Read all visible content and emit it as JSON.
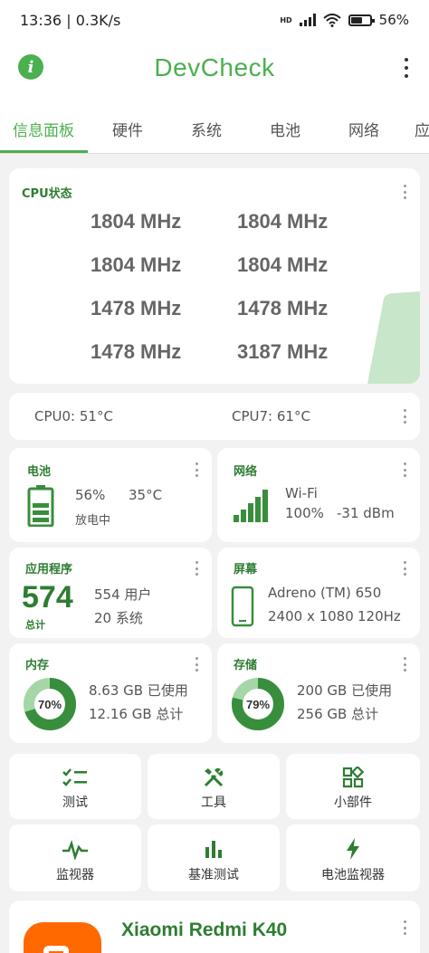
{
  "status_bar": {
    "time": "13:36",
    "speed": "0.3K/s",
    "battery": "56%",
    "network_badge": "HD"
  },
  "app_bar": {
    "title": "DevCheck"
  },
  "tabs": [
    {
      "label": "信息面板"
    },
    {
      "label": "硬件"
    },
    {
      "label": "系统"
    },
    {
      "label": "电池"
    },
    {
      "label": "网络"
    },
    {
      "label": "应"
    }
  ],
  "cpu_card": {
    "title": "CPU状态",
    "freqs": [
      "1804 MHz",
      "1804 MHz",
      "1804 MHz",
      "1804 MHz",
      "1478 MHz",
      "1478 MHz",
      "1478 MHz",
      "3187 MHz"
    ],
    "load_level": 0.78
  },
  "temp_card": {
    "cpu0": "CPU0: 51°C",
    "cpu7": "CPU7: 61°C"
  },
  "battery_card": {
    "title": "电池",
    "level": "56%",
    "temp": "35°C",
    "status": "放电中"
  },
  "network_card": {
    "title": "网络",
    "type": "Wi-Fi",
    "signal_pct": "100%",
    "signal_dbm": "-31 dBm"
  },
  "apps_card": {
    "title": "应用程序",
    "total": "574",
    "total_label": "总计",
    "user": "554 用户",
    "system": "20 系统"
  },
  "screen_card": {
    "title": "屏幕",
    "gpu": "Adreno (TM) 650",
    "resolution": "2400 x 1080",
    "refresh": "120Hz"
  },
  "memory_card": {
    "title": "内存",
    "percent": "70%",
    "percent_value": 70,
    "used": "8.63 GB 已使用",
    "total": "12.16 GB 总计"
  },
  "storage_card": {
    "title": "存储",
    "percent": "79%",
    "percent_value": 79,
    "used": "200 GB 已使用",
    "total": "256 GB 总计"
  },
  "tools": [
    {
      "label": "测试",
      "icon": "checklist-icon"
    },
    {
      "label": "工具",
      "icon": "tools-icon"
    },
    {
      "label": "小部件",
      "icon": "widgets-icon"
    },
    {
      "label": "监视器",
      "icon": "pulse-icon"
    },
    {
      "label": "基准测试",
      "icon": "bar-chart-icon"
    },
    {
      "label": "电池监视器",
      "icon": "bolt-icon"
    }
  ],
  "device_card": {
    "name": "Xiaomi Redmi K40"
  },
  "colors": {
    "accent": "#4caf50",
    "accent_dark": "#2e7d32",
    "card": "#ffffff",
    "background": "#f2f2f2"
  }
}
